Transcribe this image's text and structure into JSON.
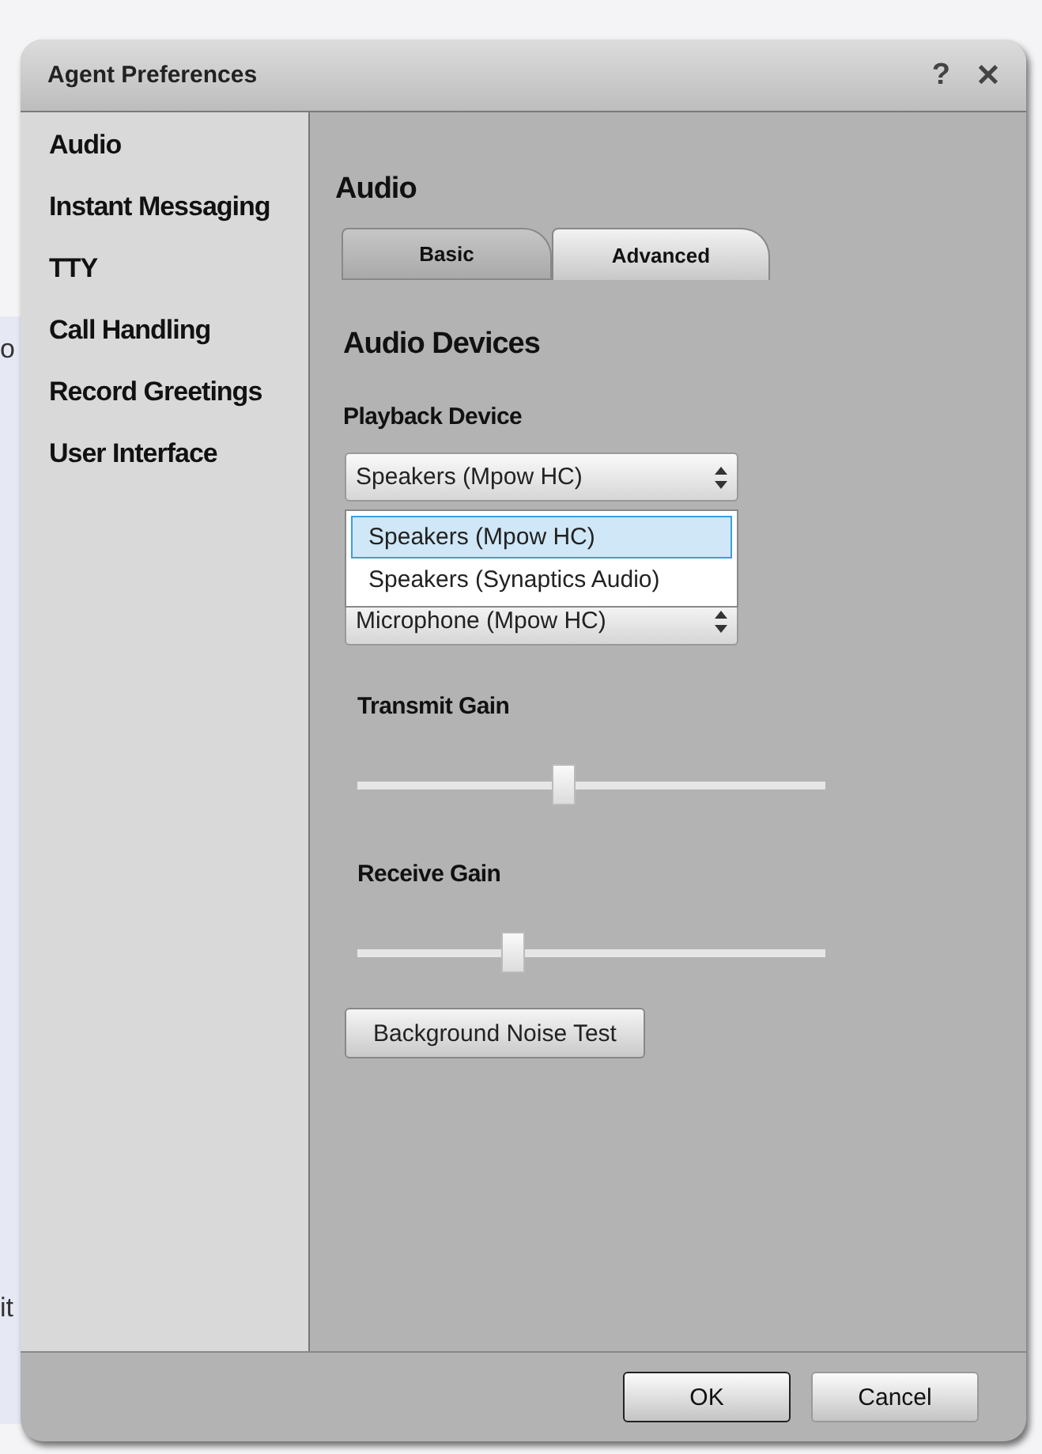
{
  "background_texts": [
    "o",
    "it"
  ],
  "window": {
    "title": "Agent Preferences",
    "help": "?",
    "close": "✕"
  },
  "sidebar": {
    "items": [
      {
        "label": "Audio"
      },
      {
        "label": "Instant Messaging"
      },
      {
        "label": "TTY"
      },
      {
        "label": "Call Handling"
      },
      {
        "label": "Record Greetings"
      },
      {
        "label": "User Interface"
      }
    ]
  },
  "content": {
    "heading": "Audio",
    "tabs": [
      {
        "label": "Basic",
        "selected": false
      },
      {
        "label": "Advanced",
        "selected": true
      }
    ],
    "section_title": "Audio Devices",
    "playback": {
      "label": "Playback Device",
      "value": "Speakers (Mpow HC)",
      "options": [
        {
          "label": "Speakers (Mpow HC)",
          "selected": true
        },
        {
          "label": "Speakers (Synaptics Audio)",
          "selected": false
        }
      ]
    },
    "recording": {
      "value": "Microphone (Mpow HC)"
    },
    "sliders": [
      {
        "label": "Transmit Gain",
        "level": 0.44
      },
      {
        "label": "Receive Gain",
        "level": 0.33
      }
    ],
    "noise_button": "Background Noise Test"
  },
  "buttons": [
    {
      "label": "OK",
      "default": true
    },
    {
      "label": "Cancel",
      "default": false
    }
  ]
}
